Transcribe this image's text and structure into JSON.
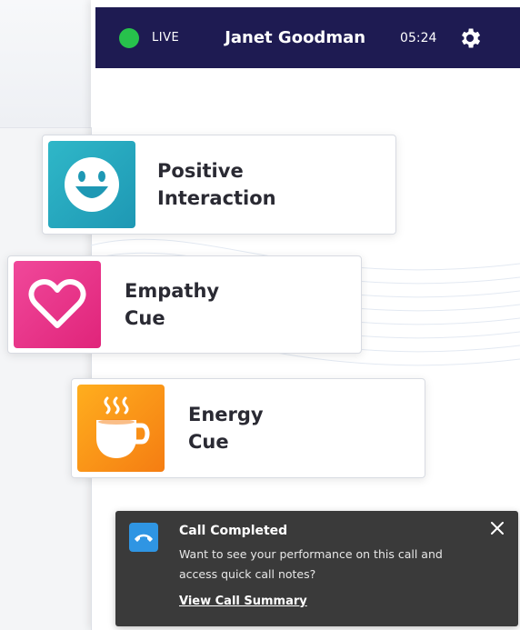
{
  "header": {
    "live_label": "LIVE",
    "agent_name": "Janet Goodman",
    "timer": "05:24",
    "icons": {
      "status": "live-status-dot",
      "settings": "gear-icon"
    }
  },
  "cues": [
    {
      "label": "Positive\nInteraction",
      "icon": "smiley-face-icon",
      "color": "#2fb7c8"
    },
    {
      "label": "Empathy\nCue",
      "icon": "heart-icon",
      "color": "#f0489a"
    },
    {
      "label": "Energy\nCue",
      "icon": "hot-coffee-cup-icon",
      "color": "#ffae1e"
    }
  ],
  "notification": {
    "title": "Call Completed",
    "body": "Want to see your performance on this call and access quick call notes?",
    "link_label": "View Call Summary",
    "icon": "hang-up-phone-icon",
    "close_icon": "close-icon"
  },
  "colors": {
    "header_bg": "#1e1b52",
    "live_green": "#27c24c",
    "toast_bg": "#3a3a3a",
    "toast_icon_bg": "#2f95e3"
  }
}
